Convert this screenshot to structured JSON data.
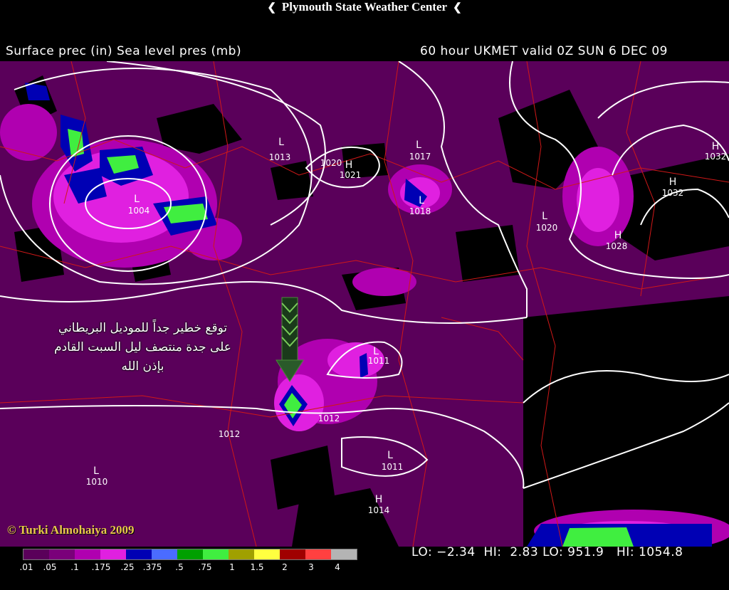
{
  "header": {
    "center_title": "Plymouth State Weather Center",
    "left_title": "Surface prec (in) Sea level pres (mb)",
    "right_title": "60 hour UKMET valid 0Z SUN  6 DEC 09"
  },
  "annotation": {
    "arabic_line1": "توقع خطير جداً للموديل البريطاني",
    "arabic_line2": "على جدة منتصف ليل السبت القادم",
    "arabic_line3": "بإذن الله",
    "copyright": "© Turki Almohaiya 2009"
  },
  "pressure_centers": [
    {
      "type": "L",
      "value": "1013"
    },
    {
      "type": "H",
      "value": "1021"
    },
    {
      "type": "",
      "value": "1020"
    },
    {
      "type": "L",
      "value": "1017"
    },
    {
      "type": "L",
      "value": "1018"
    },
    {
      "type": "L",
      "value": "1004"
    },
    {
      "type": "L",
      "value": "1020"
    },
    {
      "type": "H",
      "value": "1032"
    },
    {
      "type": "H",
      "value": "1032"
    },
    {
      "type": "H",
      "value": "1028"
    },
    {
      "type": "L",
      "value": "1011"
    },
    {
      "type": "",
      "value": "1012"
    },
    {
      "type": "",
      "value": "1012"
    },
    {
      "type": "L",
      "value": "1011"
    },
    {
      "type": "L",
      "value": "1010"
    },
    {
      "type": "H",
      "value": "1014"
    }
  ],
  "legend": {
    "colors": [
      "#5a005a",
      "#7a007a",
      "#b000b0",
      "#e020e0",
      "#0000b4",
      "#4a6cff",
      "#00a000",
      "#40ee40",
      "#a0a000",
      "#ffff40",
      "#a00000",
      "#ff4040",
      "#b4b4b4"
    ],
    "labels": [
      ".01",
      ".05",
      ".1",
      ".175",
      ".25",
      ".375",
      ".5",
      ".75",
      "1",
      "1.5",
      "2",
      "3",
      "4"
    ]
  },
  "stats": "LO: −2.34  HI:  2.83 LO: 951.9   HI: 1054.8"
}
